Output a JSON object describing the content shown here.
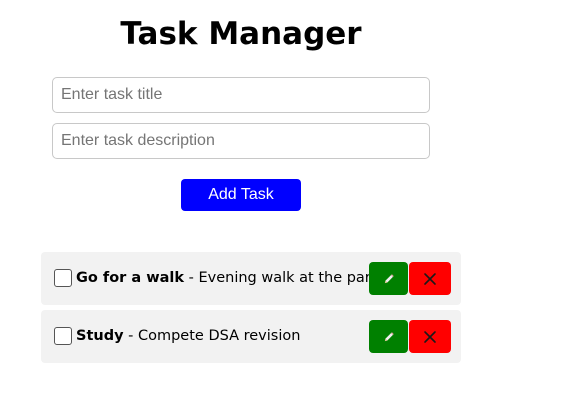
{
  "header": {
    "title": "Task Manager"
  },
  "form": {
    "title_placeholder": "Enter task title",
    "title_value": "",
    "description_placeholder": "Enter task description",
    "description_value": "",
    "add_label": "Add Task"
  },
  "tasks": [
    {
      "title": "Go for a walk",
      "separator": " - ",
      "description": "Evening walk at the park",
      "completed": false,
      "edit_icon": "pencil-icon",
      "delete_icon": "close-icon"
    },
    {
      "title": "Study",
      "separator": " - ",
      "description": "Compete DSA revision",
      "completed": false,
      "edit_icon": "pencil-icon",
      "delete_icon": "close-icon"
    }
  ],
  "colors": {
    "add_button": "#0000ff",
    "edit_button": "#008000",
    "delete_button": "#ff0000",
    "task_background": "#f2f2f2"
  }
}
